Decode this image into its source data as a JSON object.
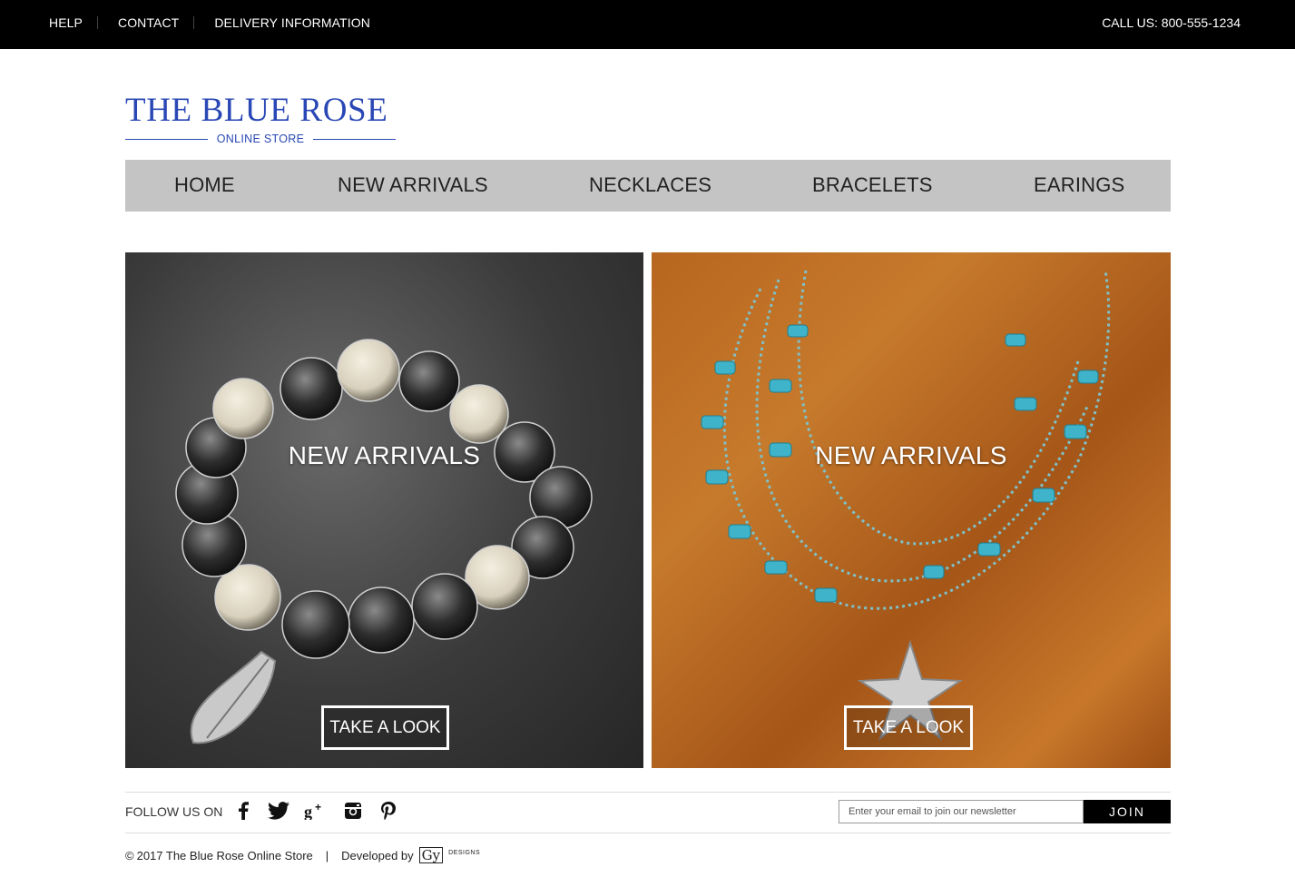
{
  "topbar": {
    "links": [
      "HELP",
      "CONTACT",
      "DELIVERY INFORMATION"
    ],
    "call": "CALL US: 800-555-1234"
  },
  "logo": {
    "name": "THE BLUE ROSE",
    "sub": "ONLINE STORE"
  },
  "nav": {
    "items": [
      "HOME",
      "NEW ARRIVALS",
      "NECKLACES",
      "BRACELETS",
      "EARINGS"
    ]
  },
  "tiles": [
    {
      "heading": "NEW ARRIVALS",
      "button": "TAKE A LOOK",
      "image": "beaded-bracelet-with-leaf-charm"
    },
    {
      "heading": "NEW ARRIVALS",
      "button": "TAKE A LOOK",
      "image": "turquoise-necklace-with-starfish"
    }
  ],
  "footer": {
    "follow_label": "FOLLOW US ON",
    "social_icons": [
      "facebook-icon",
      "twitter-icon",
      "google-plus-icon",
      "instagram-icon",
      "pinterest-icon"
    ],
    "newsletter_placeholder": "Enter your email to join our newsletter",
    "join_label": "JOIN",
    "copyright_symbol": "©",
    "copyright": "2017 The Blue Rose Online Store",
    "separator": "|",
    "developed_by": "Developed by",
    "dev_mark": "Gy",
    "dev_designs": "DESIGNS"
  }
}
